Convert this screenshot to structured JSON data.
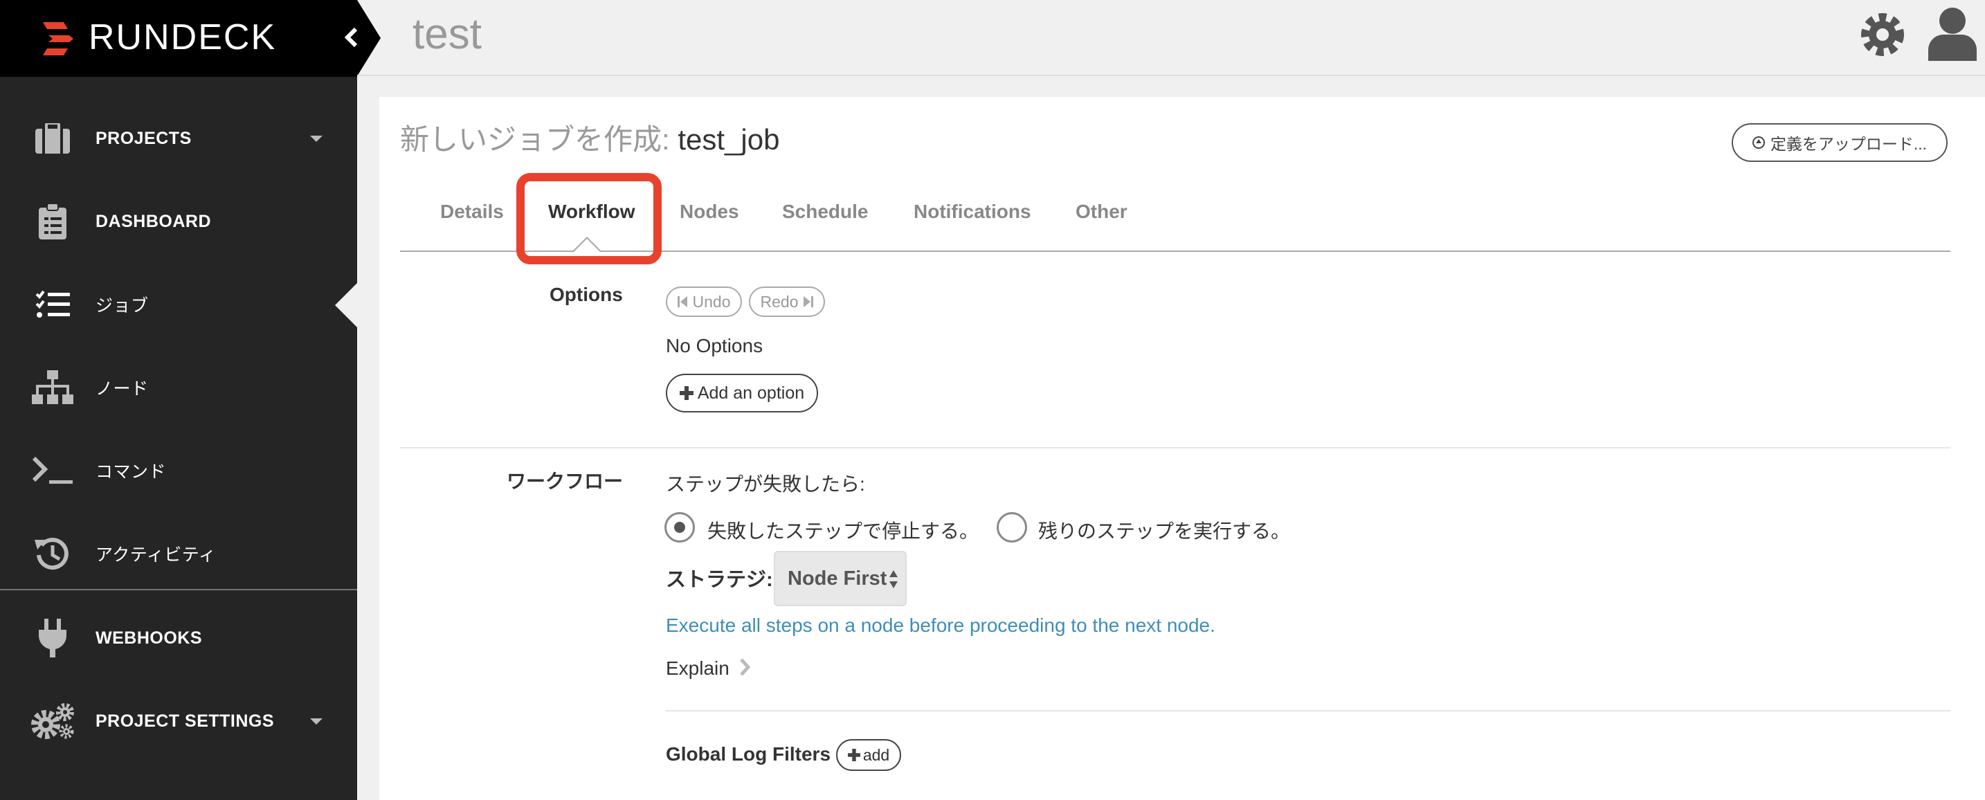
{
  "brand": {
    "name": "RUNDECK",
    "accent": "#e8422d"
  },
  "header": {
    "project_title": "test"
  },
  "sidebar": {
    "items": [
      {
        "label": "PROJECTS",
        "icon": "briefcase-icon",
        "has_caret": true
      },
      {
        "label": "DASHBOARD",
        "icon": "clipboard-icon",
        "has_caret": false
      },
      {
        "label": "ジョブ",
        "icon": "job-list-icon",
        "has_caret": false
      },
      {
        "label": "ノード",
        "icon": "node-tree-icon",
        "has_caret": false
      },
      {
        "label": "コマンド",
        "icon": "terminal-icon",
        "has_caret": false
      },
      {
        "label": "アクティビティ",
        "icon": "history-icon",
        "has_caret": false
      },
      {
        "label": "WEBHOOKS",
        "icon": "plug-icon",
        "has_caret": false
      },
      {
        "label": "PROJECT SETTINGS",
        "icon": "gears-icon",
        "has_caret": true
      }
    ]
  },
  "job": {
    "title_prefix": "新しいジョブを作成:",
    "name": "test_job",
    "upload_label": "定義をアップロード..."
  },
  "tabs": [
    {
      "label": "Details"
    },
    {
      "label": "Workflow",
      "active": true
    },
    {
      "label": "Nodes"
    },
    {
      "label": "Schedule"
    },
    {
      "label": "Notifications"
    },
    {
      "label": "Other"
    }
  ],
  "options": {
    "label": "Options",
    "undo_label": "Undo",
    "redo_label": "Redo",
    "empty_text": "No Options",
    "add_label": "Add an option"
  },
  "workflow": {
    "label": "ワークフロー",
    "on_fail_label": "ステップが失敗したら:",
    "radio_stop": "失敗したステップで停止する。",
    "radio_continue": "残りのステップを実行する。",
    "strategy_label": "ストラテジ:",
    "strategy_value": "Node First",
    "strategy_desc": "Execute all steps on a node before proceeding to the next node.",
    "explain_label": "Explain",
    "log_filters_label": "Global Log Filters",
    "add_label": "add"
  }
}
